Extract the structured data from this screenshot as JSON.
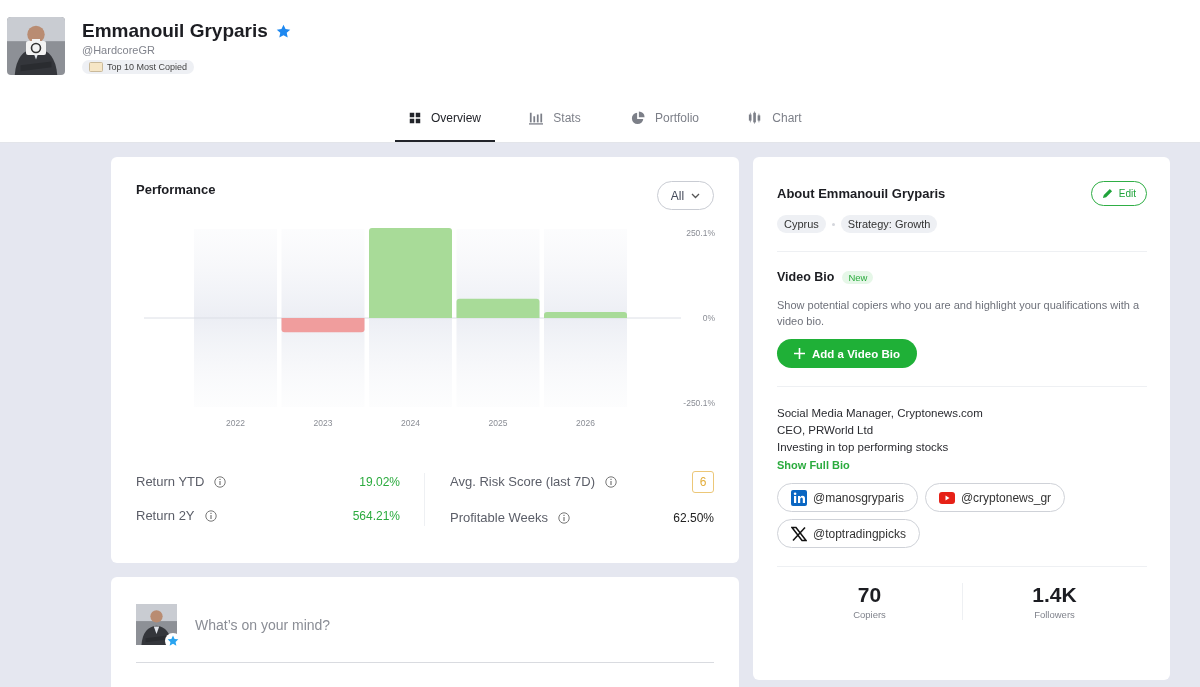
{
  "profile": {
    "name": "Emmanouil Gryparis",
    "verified": true,
    "handle": "@HardcoreGR",
    "badge": "Top 10 Most Copied"
  },
  "tabs": [
    {
      "label": "Overview",
      "selected": true
    },
    {
      "label": "Stats",
      "selected": false
    },
    {
      "label": "Portfolio",
      "selected": false
    },
    {
      "label": "Chart",
      "selected": false
    }
  ],
  "performance": {
    "title": "Performance",
    "period": "All",
    "chart_data": {
      "type": "bar",
      "categories": [
        "2022",
        "2023",
        "2024",
        "2025",
        "2026"
      ],
      "series": [
        {
          "color": "#a8db98",
          "values": [
            null,
            null,
            265,
            57,
            18
          ]
        },
        {
          "color": "#f09d9d",
          "values": [
            null,
            -42,
            null,
            null,
            null
          ]
        }
      ],
      "stacked": true,
      "yticks": [
        {
          "value": 250.1,
          "label": "250.1%"
        },
        {
          "value": 0,
          "label": "0%"
        },
        {
          "value": -250.1,
          "label": "-250.1%"
        }
      ],
      "ylim": [
        -270,
        270
      ]
    },
    "stats": [
      {
        "label": "Return YTD",
        "value": "19.02%",
        "kind": "gain"
      },
      {
        "label": "Return 2Y",
        "value": "564.21%",
        "kind": "gain"
      },
      {
        "label": "Avg. Risk Score (last 7D)",
        "value": "6",
        "kind": "risk"
      },
      {
        "label": "Profitable Weeks",
        "value": "62.50%",
        "kind": "plain"
      }
    ]
  },
  "composer": {
    "placeholder": "What’s on your mind?",
    "verified": true
  },
  "about": {
    "title": "About Emmanouil Gryparis",
    "edit": "Edit",
    "tags": [
      "Cyprus",
      "Strategy: Growth"
    ],
    "video_bio": {
      "title": "Video Bio",
      "badge": "New",
      "text": "Show potential copiers who you are and highlight your qualifications with a video bio.",
      "button": "Add a Video Bio"
    },
    "bio_lines": [
      "Social Media Manager, Cryptonews.com",
      "CEO, PRWorld Ltd",
      "Investing in top performing stocks"
    ],
    "show_full": "Show Full Bio",
    "socials": [
      {
        "kind": "linkedin",
        "handle": "@manosgryparis"
      },
      {
        "kind": "youtube",
        "handle": "@cryptonews_gr"
      },
      {
        "kind": "x",
        "handle": "@toptradingpicks"
      }
    ],
    "counts": [
      {
        "value": "70",
        "label": "Copiers"
      },
      {
        "value": "1.4K",
        "label": "Followers"
      }
    ]
  }
}
